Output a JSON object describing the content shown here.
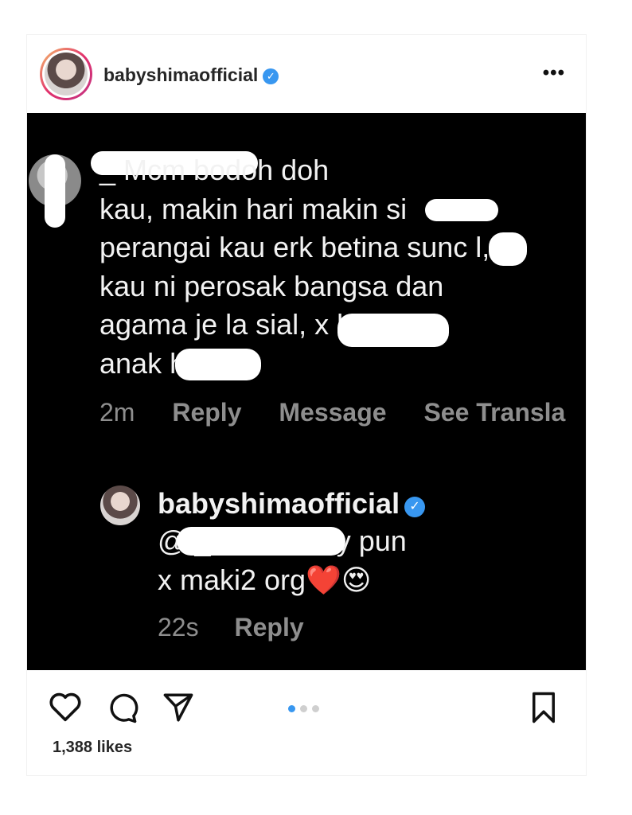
{
  "post": {
    "username": "babyshimaofficial",
    "verified_icon": "verified-badge-icon",
    "more_icon": "more-options-icon"
  },
  "comment": {
    "text": "_ Mcm bodoh doh\nkau, makin hari makin si\nperangai kau erk betina sunc    l,\nkau ni perosak bangsa dan\nagama je la sial,              x betul\nanak h          n 😂",
    "time": "2m",
    "reply_label": "Reply",
    "message_label": "Message",
    "translate_label": "See Transla"
  },
  "reply": {
    "username": "babyshimaofficial",
    "text": "@                         _ bodoh2 sy pun\nx maki2 org❤️😍",
    "time": "22s",
    "reply_label": "Reply"
  },
  "actions": {
    "like_icon": "heart-icon",
    "comment_icon": "comment-icon",
    "share_icon": "share-icon",
    "save_icon": "bookmark-icon",
    "carousel_count": 3,
    "carousel_active": 1
  },
  "likes": "1,388 likes",
  "colors": {
    "verified": "#3897f0",
    "post_background": "#000000",
    "meta_gray": "#8e8e8e"
  }
}
